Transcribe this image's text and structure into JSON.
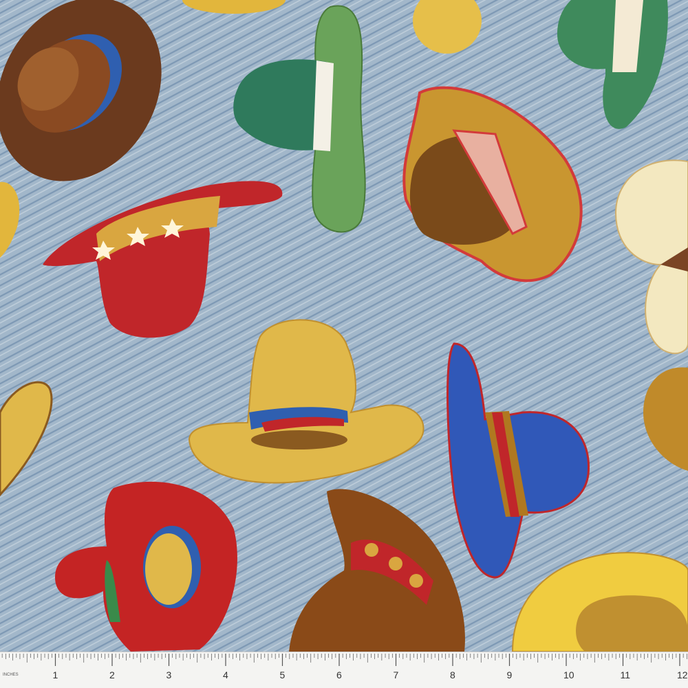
{
  "image": {
    "subject": "cowboy-hat-print-fabric",
    "background_color": "#9fb4c8",
    "denim_line_color": "#6f8fae"
  },
  "ruler": {
    "unit_label": "INCHES",
    "numbers": [
      "1",
      "2",
      "3",
      "4",
      "5",
      "6",
      "7",
      "8",
      "9",
      "10",
      "11",
      "12"
    ]
  },
  "hats": [
    {
      "name": "brown-hat",
      "crown": "#6b3a1e",
      "brim": "#7a4424",
      "band": "#2f5fb0"
    },
    {
      "name": "green-hat",
      "crown": "#2f7a5c",
      "brim": "#6aa35a",
      "band": "#ffffff"
    },
    {
      "name": "red-star-hat",
      "crown": "#a3181a",
      "brim": "#c0262a",
      "band": "#d9a640"
    },
    {
      "name": "tan-striped-hat",
      "crown": "#8a5a20",
      "brim": "#c99630",
      "band": "#d33a3a"
    },
    {
      "name": "cream-hat",
      "crown": "#f3e8c0",
      "brim": "#f8eed0",
      "band": "#7a4424"
    },
    {
      "name": "yellow-tall-hat",
      "crown": "#d8b040",
      "brim": "#e0b84a",
      "band": "#2f5fb0"
    },
    {
      "name": "blue-hat",
      "crown": "#2848a0",
      "brim": "#3058b8",
      "band": "#c0262a"
    },
    {
      "name": "red-round-hat",
      "crown": "#b81c1c",
      "brim": "#c42424",
      "band": "#2f5fb0"
    },
    {
      "name": "brown-studded-hat",
      "crown": "#8a4a18",
      "brim": "#a0622a",
      "band": "#c0262a"
    },
    {
      "name": "yellow-corner-hat",
      "crown": "#e8c030",
      "brim": "#f0cc40",
      "band": "#8a5a20"
    }
  ]
}
